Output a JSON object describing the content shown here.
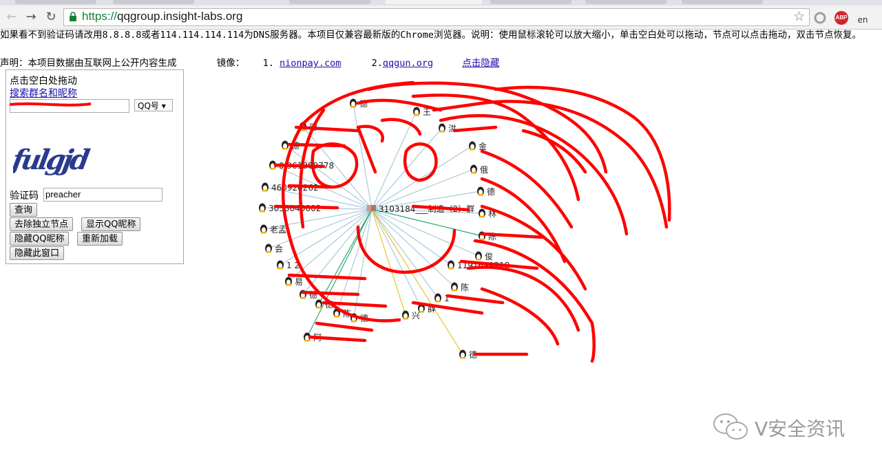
{
  "browser": {
    "url_protocol": "https://",
    "url_host": "qqgroup.insight-labs.org",
    "back_icon": "arrow-left-icon",
    "forward_icon": "arrow-right-icon",
    "reload_icon": "reload-icon",
    "extensions": [
      {
        "name": "circle-extension-icon",
        "color": "#9e9e9e"
      },
      {
        "name": "abp-extension-icon",
        "label": "ABP",
        "color": "#d6232b"
      },
      {
        "name": "language-extension-icon",
        "label": "en",
        "color": "#555555"
      }
    ],
    "accent_color": "#188038"
  },
  "page": {
    "info_line": "如果看不到验证码请改用8.8.8.8或者114.114.114.114为DNS服务器。本项目仅兼容最新版的Chrome浏览器。说明：使用鼠标滚轮可以放大缩小，单击空白处可以拖动，节点可以点击拖动，双击节点恢复。",
    "declaration": "声明：本项目数据由互联网上公开内容生成",
    "mirror_label": "镜像：",
    "mirror_1_index": "1.",
    "mirror_1": "nionpay.com",
    "mirror_2_index": "2.",
    "mirror_2": "qqgun.org",
    "hide_link": "点击隐藏"
  },
  "panel": {
    "drag_hint": "点击空白处拖动",
    "search_link": "搜索群名和昵称",
    "search_value": "",
    "search_type": "QQ号",
    "captcha_text": "fulgjd",
    "captcha_label": "验证码",
    "captcha_value": "preacher",
    "buttons": {
      "query": "查询",
      "remove_isolated": "去除独立节点",
      "show_nick": "显示QQ昵称",
      "hide_nick": "隐藏QQ昵称",
      "reload": "重新加载",
      "hide_window": "隐藏此窗口"
    }
  },
  "graph": {
    "center_label": "3103184___制造（2）群",
    "node_labels": [
      "德",
      "王",
      "德",
      "洪",
      "德",
      "金",
      "0 961809778",
      "俄",
      "460920262",
      "德",
      "3033040002",
      "林",
      "老孟",
      "陈",
      "会",
      "俊",
      "1  2",
      "1191699218",
      "易",
      "陈",
      "德",
      "1",
      "德",
      "薛",
      "陈",
      "兴",
      "德",
      "阿",
      "德"
    ],
    "edge_color": "#a9c9d8",
    "highlight_edge_colors": [
      "#2aa86e",
      "#e8c42c"
    ],
    "scribble_color": "#ff0000"
  },
  "watermark": {
    "text": "V安全资讯",
    "logo_icon": "wechat-logo-icon"
  }
}
